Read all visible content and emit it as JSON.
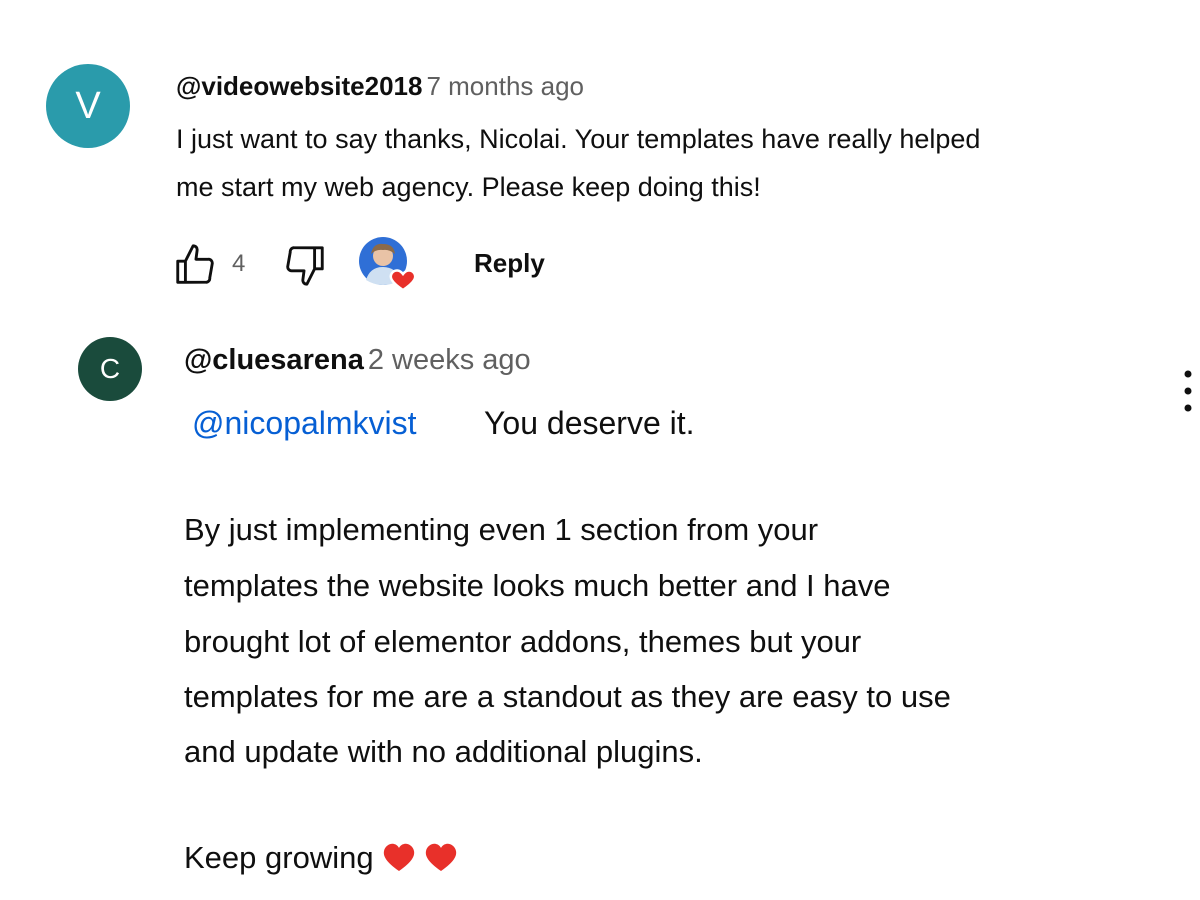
{
  "comment": {
    "avatar_letter": "V",
    "avatar_color": "#2a9bab",
    "author": "@videowebsite2018",
    "time": "7 months ago",
    "lines": [
      "I just want to say thanks, Nicolai. Your templates have really helped",
      "me start my web agency. Please keep doing this!"
    ],
    "likes": "4",
    "reply_label": "Reply",
    "creator_heart": true
  },
  "reply": {
    "avatar_letter": "C",
    "avatar_color": "#1a4b3c",
    "author": "@cluesarena",
    "time": "2 weeks ago",
    "mention": "@nicopalmkvist",
    "first_line": "You deserve it.",
    "lines": [
      "By just implementing even 1 section from your",
      "templates the website looks much better and I have",
      "brought lot of elementor addons, themes but your",
      "templates for me are a standout as they are easy to use",
      "and update with no additional plugins."
    ],
    "closing": "Keep growing",
    "emoji_hearts": 2
  },
  "colors": {
    "link": "#065fd4",
    "secondary_text": "#606060",
    "heart": "#e8302a"
  },
  "icons": [
    "thumbs-up-icon",
    "thumbs-down-icon",
    "creator-heart-icon",
    "more-vert-icon",
    "heart-emoji-icon"
  ]
}
